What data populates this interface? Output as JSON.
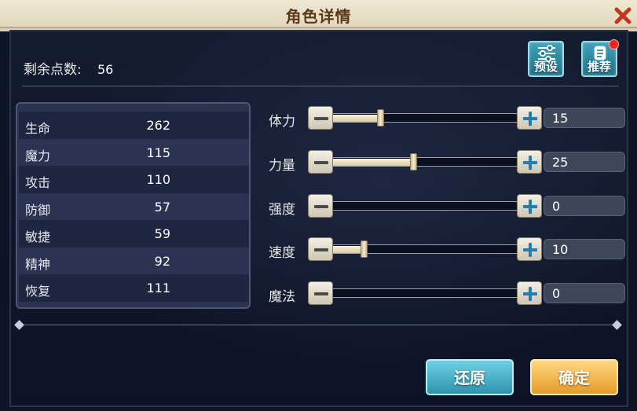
{
  "window": {
    "title": "角色详情",
    "close_icon": "close-x-icon"
  },
  "points": {
    "label": "剩余点数:",
    "value": "56"
  },
  "header_buttons": {
    "preset_label": "预设",
    "preset_icon": "sliders-icon",
    "recommend_label": "推荐",
    "recommend_icon": "scroll-icon",
    "recommend_has_notification": true
  },
  "stats": [
    {
      "name": "生命",
      "value": "262"
    },
    {
      "name": "魔力",
      "value": "115"
    },
    {
      "name": "攻击",
      "value": "110"
    },
    {
      "name": "防御",
      "value": "57"
    },
    {
      "name": "敏捷",
      "value": "59"
    },
    {
      "name": "精神",
      "value": "92"
    },
    {
      "name": "恢复",
      "value": "111"
    }
  ],
  "sliders": [
    {
      "label": "体力",
      "value": "15",
      "fill_fraction": 0.26
    },
    {
      "label": "力量",
      "value": "25",
      "fill_fraction": 0.44
    },
    {
      "label": "强度",
      "value": "0",
      "fill_fraction": 0.0
    },
    {
      "label": "速度",
      "value": "10",
      "fill_fraction": 0.17
    },
    {
      "label": "魔法",
      "value": "0",
      "fill_fraction": 0.0
    }
  ],
  "footer": {
    "restore_label": "还原",
    "confirm_label": "确定"
  },
  "colors": {
    "title_text": "#5a3a16",
    "close_icon": "#c0391b",
    "teal_button": "#2d94ae",
    "gold_button": "#e59a2a",
    "notification_dot": "#e8261f"
  }
}
